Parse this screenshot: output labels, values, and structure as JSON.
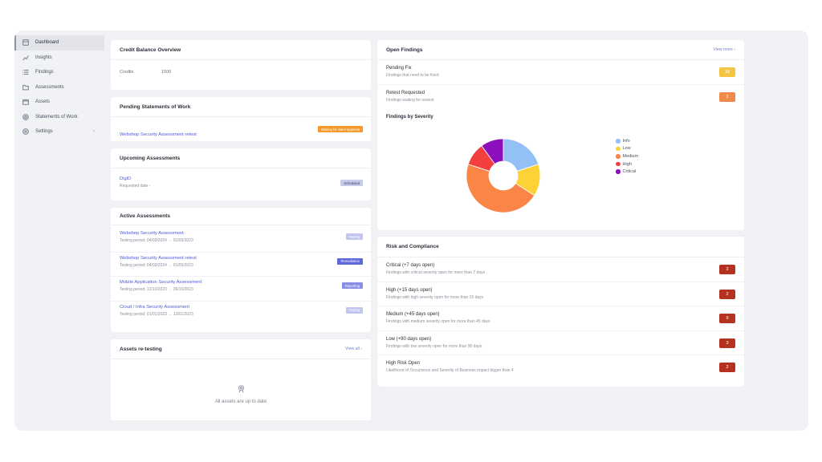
{
  "sidebar": {
    "items": [
      {
        "label": "Dashboard",
        "icon": "dashboard-icon",
        "active": true
      },
      {
        "label": "Insights",
        "icon": "chart-line-icon"
      },
      {
        "label": "Findings",
        "icon": "list-icon"
      },
      {
        "label": "Assessments",
        "icon": "folder-icon"
      },
      {
        "label": "Assets",
        "icon": "box-icon"
      },
      {
        "label": "Statements of Work",
        "icon": "document-icon"
      },
      {
        "label": "Settings",
        "icon": "gear-icon",
        "chevron": "›"
      }
    ]
  },
  "credit": {
    "title": "Credit Balance Overview",
    "label": "Credits",
    "value": "1500"
  },
  "pending_sow": {
    "title": "Pending Statements of Work",
    "item": "Webshop Security Assessment retest",
    "status": "Waiting for client approval"
  },
  "upcoming": {
    "title": "Upcoming Assessments",
    "name": "DigiD",
    "sub": "Requested date -",
    "status": "Scheduled"
  },
  "active": {
    "title": "Active Assessments",
    "rows": [
      {
        "name": "Webshop Security Assessment",
        "period": "Testing period: 04/03/2024 → 01/05/2023",
        "status": "Testing",
        "color": "#c3c6ef"
      },
      {
        "name": "Webshop Security Assessment retest",
        "period": "Testing period: 04/03/2024 → 01/05/2023",
        "status": "Remediation",
        "color": "#5c67d9"
      },
      {
        "name": "Mobile Application Security Assessment",
        "period": "Testing period: 12/10/2023 → 26/10/2023",
        "status": "Reporting",
        "color": "#8a8fe6"
      },
      {
        "name": "Cloud / Infra Security Assessment",
        "period": "Testing period: 01/01/2023 → 13/01/2023",
        "status": "Testing",
        "color": "#c3c6ef"
      }
    ]
  },
  "retesting": {
    "title": "Assets re-testing",
    "view_all": "View all ›",
    "empty": "All assets are up to date"
  },
  "open_findings": {
    "title": "Open Findings",
    "view_more": "View more ›",
    "rows": [
      {
        "title": "Pending Fix",
        "sub": "Findings that need to be fixed",
        "count": "18",
        "color": "#f5c542"
      },
      {
        "title": "Retest Requested",
        "sub": "Findings waiting for restest",
        "count": "2",
        "color": "#f08a4b"
      }
    ],
    "severity_title": "Findings by Severity"
  },
  "chart_data": {
    "type": "pie",
    "title": "Findings by Severity",
    "labels": [
      "Info",
      "Low",
      "Medium",
      "High",
      "Critical"
    ],
    "values": [
      20,
      14,
      46,
      10,
      10
    ],
    "colors": [
      "#93c0f5",
      "#fdd236",
      "#fb8546",
      "#f3403f",
      "#8d0ebd"
    ]
  },
  "risk": {
    "title": "Risk and Compliance",
    "rows": [
      {
        "title": "Critical (+7 days open)",
        "sub": "Findings with critical severity open for more than 7 days",
        "count": "2"
      },
      {
        "title": "High (+15 days open)",
        "sub": "Findings with high severity open for more than 15 days",
        "count": "2"
      },
      {
        "title": "Medium (+45 days open)",
        "sub": "Findings with medium severity open for more than 45 days",
        "count": "9"
      },
      {
        "title": "Low (+90 days open)",
        "sub": "Findings with low severity open for more than 90 days",
        "count": "3"
      },
      {
        "title": "High Risk Open",
        "sub": "Likelihood of Occurrence and Severity of Business Impact bigger than 4",
        "count": "2"
      }
    ],
    "badge_color": "#b4321f"
  },
  "colors": {
    "waiting": "#f39a2a",
    "scheduled": "#c7cbea"
  }
}
